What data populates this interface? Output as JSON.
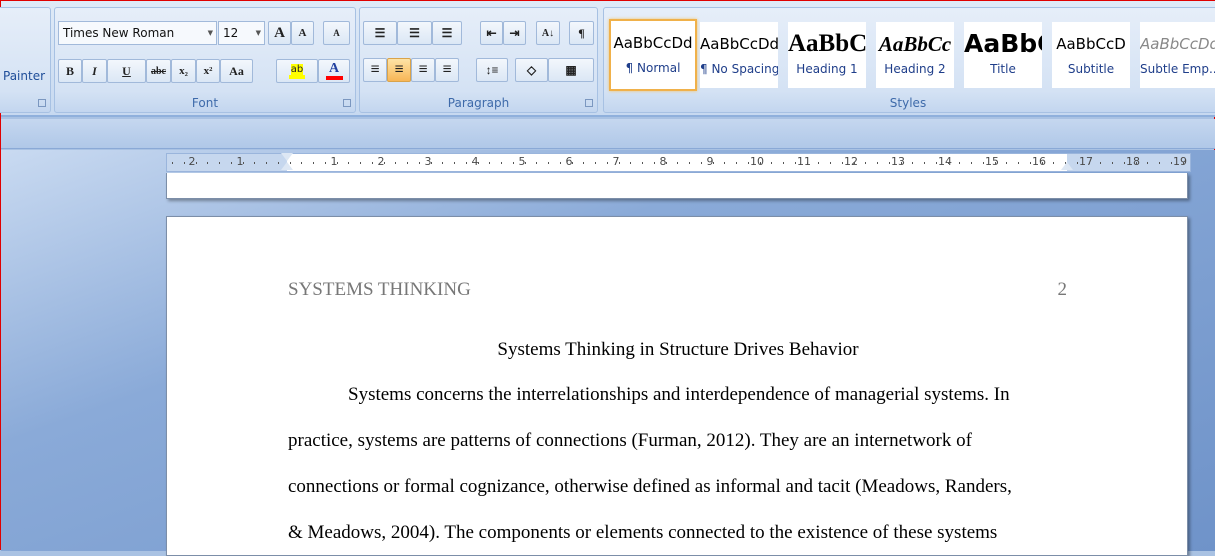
{
  "ribbon": {
    "clipboard": {
      "format_painter_label": "Painter"
    },
    "font": {
      "label": "Font",
      "font_name": "Times New Roman",
      "font_size": "12",
      "grow": "A",
      "shrink": "A",
      "clear": "A",
      "bold": "B",
      "italic": "I",
      "underline": "U",
      "strike": "abc",
      "subscript": "x₂",
      "superscript": "x²",
      "change_case": "Aa",
      "highlight": "ab",
      "font_color": "A",
      "highlight_color": "#ffff00",
      "font_color_value": "#ff0000"
    },
    "paragraph": {
      "label": "Paragraph",
      "bullets": "☰",
      "numbering": "☰",
      "multilevel": "☰",
      "decrease_indent": "⇤",
      "increase_indent": "⇥",
      "sort": "A↓",
      "show_marks": "¶",
      "align_left": "≡",
      "align_center": "≡",
      "align_right": "≡",
      "justify": "≡",
      "line_spacing": "↕≡",
      "shading": "◇",
      "borders": "▦",
      "active_alignment": "center"
    },
    "styles": {
      "label": "Styles",
      "items": [
        {
          "sample": "AaBbCcDd",
          "name": "¶ Normal",
          "selected": true
        },
        {
          "sample": "AaBbCcDd",
          "name": "¶ No Spacing"
        },
        {
          "sample": "AaBbC",
          "name": "Heading 1"
        },
        {
          "sample": "AaBbCc",
          "name": "Heading 2"
        },
        {
          "sample": "AaBbC",
          "name": "Title"
        },
        {
          "sample": "AaBbCcD",
          "name": "Subtitle"
        },
        {
          "sample": "AaBbCcDd",
          "name": "Subtle Emp..."
        }
      ]
    }
  },
  "ruler": {
    "left_labels": [
      "2",
      "1"
    ],
    "labels": [
      "1",
      "2",
      "3",
      "4",
      "5",
      "6",
      "7",
      "8",
      "9",
      "10",
      "11",
      "12",
      "13",
      "14",
      "15",
      "16",
      "17",
      "18",
      "19"
    ]
  },
  "document": {
    "running_head": "SYSTEMS THINKING",
    "page_number": "2",
    "title": "Systems Thinking in Structure Drives Behavior",
    "lines": [
      "Systems concerns the interrelationships and interdependence of managerial systems. In",
      "practice, systems are patterns of connections (Furman, 2012). They are an internetwork of",
      "connections or formal cognizance, otherwise defined as informal and tacit (Meadows, Randers,",
      "& Meadows, 2004). The components or elements connected to the  existence of these systems"
    ]
  }
}
